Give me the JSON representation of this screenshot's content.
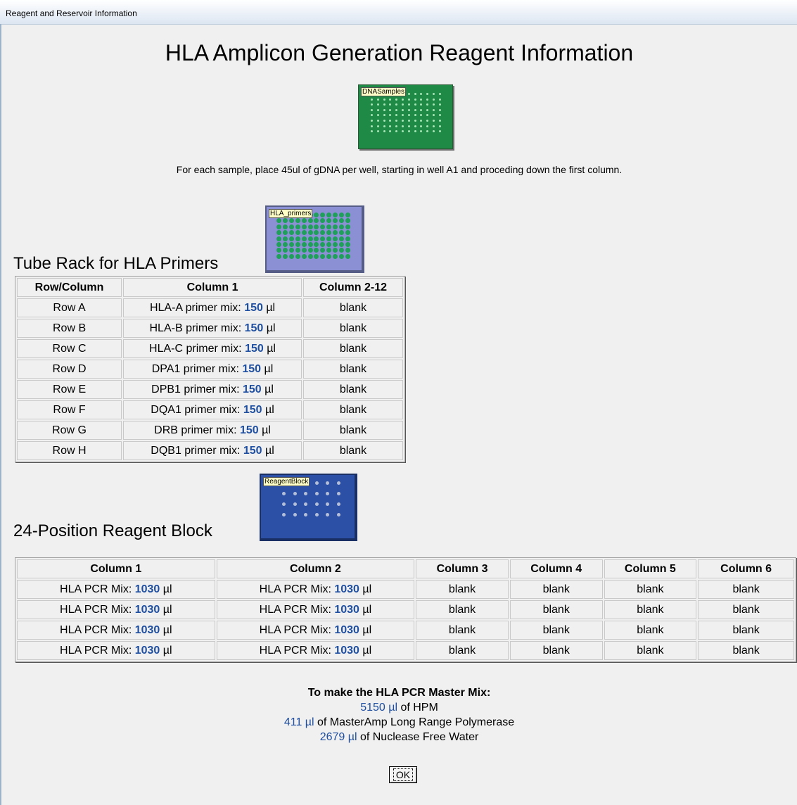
{
  "window": {
    "title": "Reagent and Reservoir Information"
  },
  "header": {
    "title": "HLA Amplicon Generation Reagent Information",
    "instruction": "For each sample, place 45ul of gDNA per well, starting in well A1 and proceding down the first column."
  },
  "plates": {
    "dna": "DNASamples",
    "primers": "HLA_primers",
    "reagent": "ReagentBlock"
  },
  "tube_rack": {
    "title": "Tube Rack for HLA Primers",
    "headers": [
      "Row/Column",
      "Column 1",
      "Column 2-12"
    ],
    "rows": [
      {
        "row": "Row A",
        "name": "HLA-A primer mix: ",
        "vol": "150",
        "unit": " µl",
        "other": "blank"
      },
      {
        "row": "Row B",
        "name": "HLA-B primer mix: ",
        "vol": "150",
        "unit": " µl",
        "other": "blank"
      },
      {
        "row": "Row C",
        "name": "HLA-C primer mix: ",
        "vol": "150",
        "unit": " µl",
        "other": "blank"
      },
      {
        "row": "Row D",
        "name": "DPA1 primer mix: ",
        "vol": "150",
        "unit": " µl",
        "other": "blank"
      },
      {
        "row": "Row E",
        "name": "DPB1 primer mix: ",
        "vol": "150",
        "unit": " µl",
        "other": "blank"
      },
      {
        "row": "Row F",
        "name": "DQA1 primer mix: ",
        "vol": "150",
        "unit": " µl",
        "other": "blank"
      },
      {
        "row": "Row G",
        "name": "DRB primer mix: ",
        "vol": "150",
        "unit": " µl",
        "other": "blank"
      },
      {
        "row": "Row H",
        "name": "DQB1 primer mix: ",
        "vol": "150",
        "unit": " µl",
        "other": "blank"
      }
    ]
  },
  "reagent_block": {
    "title": "24-Position Reagent Block",
    "headers": [
      "Column 1",
      "Column 2",
      "Column 3",
      "Column 4",
      "Column 5",
      "Column 6"
    ],
    "rows": [
      {
        "c1_name": "HLA PCR Mix: ",
        "c1_vol": "1030",
        "c1_unit": " µl",
        "c2_name": "HLA PCR Mix: ",
        "c2_vol": "1030",
        "c2_unit": " µl",
        "c3": "blank",
        "c4": "blank",
        "c5": "blank",
        "c6": "blank"
      },
      {
        "c1_name": "HLA PCR Mix: ",
        "c1_vol": "1030",
        "c1_unit": " µl",
        "c2_name": "HLA PCR Mix: ",
        "c2_vol": "1030",
        "c2_unit": " µl",
        "c3": "blank",
        "c4": "blank",
        "c5": "blank",
        "c6": "blank"
      },
      {
        "c1_name": "HLA PCR Mix: ",
        "c1_vol": "1030",
        "c1_unit": " µl",
        "c2_name": "HLA PCR Mix: ",
        "c2_vol": "1030",
        "c2_unit": " µl",
        "c3": "blank",
        "c4": "blank",
        "c5": "blank",
        "c6": "blank"
      },
      {
        "c1_name": "HLA PCR Mix: ",
        "c1_vol": "1030",
        "c1_unit": " µl",
        "c2_name": "HLA PCR Mix: ",
        "c2_vol": "1030",
        "c2_unit": " µl",
        "c3": "blank",
        "c4": "blank",
        "c5": "blank",
        "c6": "blank"
      }
    ]
  },
  "master_mix": {
    "title": "To make the HLA PCR Master Mix:",
    "lines": [
      {
        "amount": "5150 µl",
        "desc": " of HPM"
      },
      {
        "amount": "411 µl",
        "desc": " of MasterAmp Long Range Polymerase"
      },
      {
        "amount": "2679 µl",
        "desc": " of Nuclease Free Water"
      }
    ]
  },
  "buttons": {
    "ok": "OK"
  },
  "colors": {
    "accent": "#1f4fa0",
    "dna_plate": "#1f8a45",
    "primers_plate": "#8b8fd3",
    "reagent_plate": "#2c50a6"
  }
}
